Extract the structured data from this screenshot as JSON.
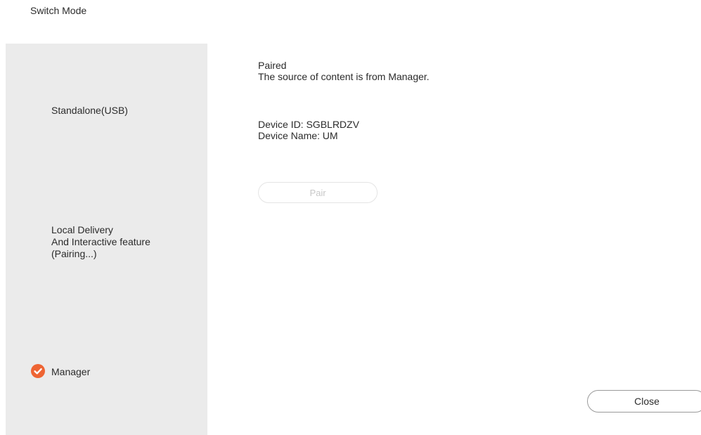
{
  "header": {
    "title": "Switch Mode"
  },
  "sidebar": {
    "modes": [
      {
        "lines": [
          "Standalone(USB)"
        ],
        "selected": false
      },
      {
        "lines": [
          "Local Delivery",
          "And Interactive feature",
          "(Pairing...)"
        ],
        "selected": false
      },
      {
        "lines": [
          "Manager"
        ],
        "selected": true,
        "icon": "check-circle-icon"
      }
    ]
  },
  "main": {
    "status_title": "Paired",
    "status_desc": "The source of content is from Manager.",
    "device_id": "Device ID: SGBLRDZV",
    "device_name": "Device Name: UM",
    "pair_label": "Pair",
    "pair_enabled": false
  },
  "footer": {
    "close_label": "Close"
  },
  "colors": {
    "accent": "#ee6433",
    "sidebar_bg": "#ebebeb",
    "disabled_text": "#c8c8c8"
  }
}
